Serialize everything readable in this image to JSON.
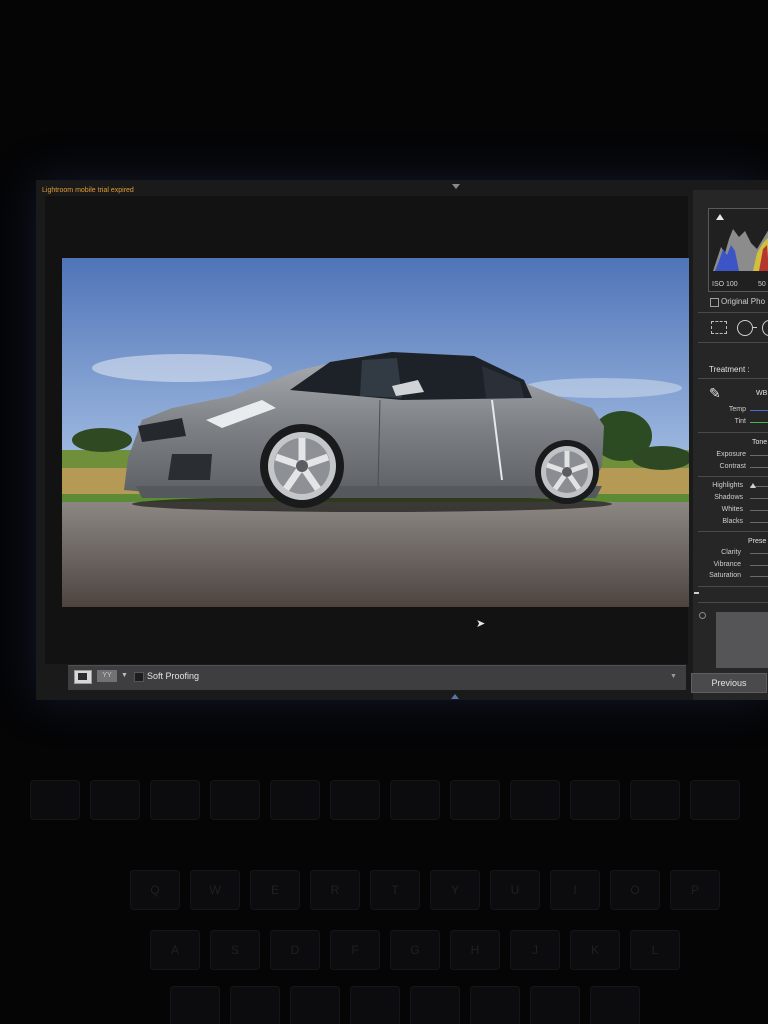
{
  "app": {
    "trial_notice": "Lightroom mobile trial expired"
  },
  "toolbar": {
    "compare_label": "YY",
    "soft_proofing_label": "Soft Proofing"
  },
  "right_panel": {
    "histogram": {
      "iso": "ISO 100",
      "value2": "50",
      "original_photo_label": "Original Pho"
    },
    "basic": {
      "treatment_label": "Treatment :",
      "wb_label": "WB",
      "temp_label": "Temp",
      "tint_label": "Tint",
      "tone_label": "Tone",
      "exposure_label": "Exposure",
      "contrast_label": "Contrast",
      "highlights_label": "Highlights",
      "shadows_label": "Shadows",
      "whites_label": "Whites",
      "blacks_label": "Blacks",
      "presence_label": "Prese",
      "clarity_label": "Clarity",
      "vibrance_label": "Vibrance",
      "saturation_label": "Saturation"
    },
    "previous_label": "Previous"
  },
  "keyboard": {
    "row1": [
      "Q",
      "W",
      "E",
      "R",
      "T",
      "Y",
      "U",
      "I",
      "O",
      "P"
    ],
    "row2": [
      "A",
      "S",
      "D",
      "F",
      "G",
      "H",
      "J",
      "K",
      "L"
    ]
  }
}
